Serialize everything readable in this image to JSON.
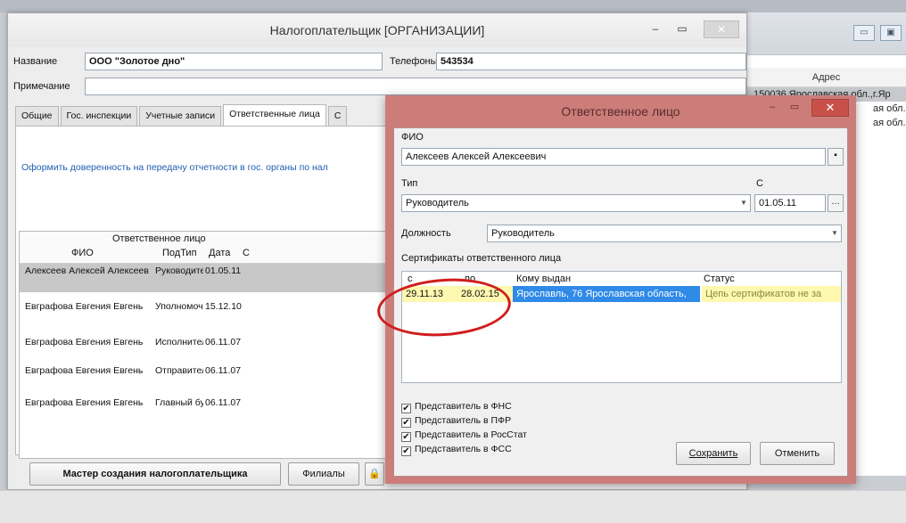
{
  "main_window": {
    "title": "Налогоплательщик [ОРГАНИЗАЦИИ]",
    "name_label": "Название",
    "name_value": "ООО \"Золотое дно\"",
    "phone_label": "Телефоны",
    "phone_value": "543534",
    "note_label": "Примечание",
    "note_value": "",
    "tabs": [
      "Общие",
      "Гос. инспекции",
      "Учетные записи",
      "Ответственные лица",
      "С"
    ],
    "link_text": "Оформить доверенность на передачу отчетности в гос. органы по нал",
    "grid": {
      "group_header": "Ответственное лицо",
      "columns": [
        "ФИО",
        "ПодТип",
        "Дата",
        "С"
      ],
      "rows": [
        {
          "fio": "Алексеев Алексей Алексеев",
          "subtype": "Руководител",
          "date": "01.05.11"
        },
        {
          "fio": "Евграфова Евгения Евгень",
          "subtype": "Уполномоче",
          "date": "15.12.10"
        },
        {
          "fio": "Евграфова Евгения Евгень",
          "subtype": "Исполнитель",
          "date": "06.11.07"
        },
        {
          "fio": "Евграфова Евгения Евгень",
          "subtype": "Отправитель",
          "date": "06.11.07"
        },
        {
          "fio": "Евграфова Евгения Евгень",
          "subtype": "Главный бух",
          "date": "06.11.07"
        }
      ]
    },
    "wizard_button": "Мастер создания налогоплательщика",
    "branches_button": "Филиалы"
  },
  "background_window": {
    "column_header": "Адрес",
    "rows": [
      "150036 Ярославская обл.,г.Яр",
      "ая обл.,г.Яр",
      "ая обл.,г.Яр"
    ]
  },
  "dialog": {
    "title": "Ответственное лицо",
    "fio_label": "ФИО",
    "fio_value": "Алексеев Алексей Алексеевич",
    "type_label": "Тип",
    "type_value": "Руководитель",
    "from_label": "С",
    "from_value": "01.05.11",
    "position_label": "Должность",
    "position_value": "Руководитель",
    "certs_label": "Сертификаты ответственного лица",
    "cert_columns": [
      "с",
      "по",
      "Кому выдан",
      "Статус"
    ],
    "cert_row": {
      "from": "29.11.13",
      "to": "28.02.15",
      "issued_to": "Ярославль, 76 Ярославская область,",
      "status": "Цепь сертификатов не за"
    },
    "checkboxes": [
      "Представитель в ФНС",
      "Представитель в ПФР",
      "Представитель в РосСтат",
      "Представитель в ФСС"
    ],
    "save_button": "Сохранить",
    "cancel_button": "Отменить"
  },
  "colors": {
    "dialog_frame": "#cc7d7a",
    "selection_blue": "#2f8ae8",
    "status_yellow": "#fff8b0",
    "annotation_red": "#d01d1d"
  }
}
